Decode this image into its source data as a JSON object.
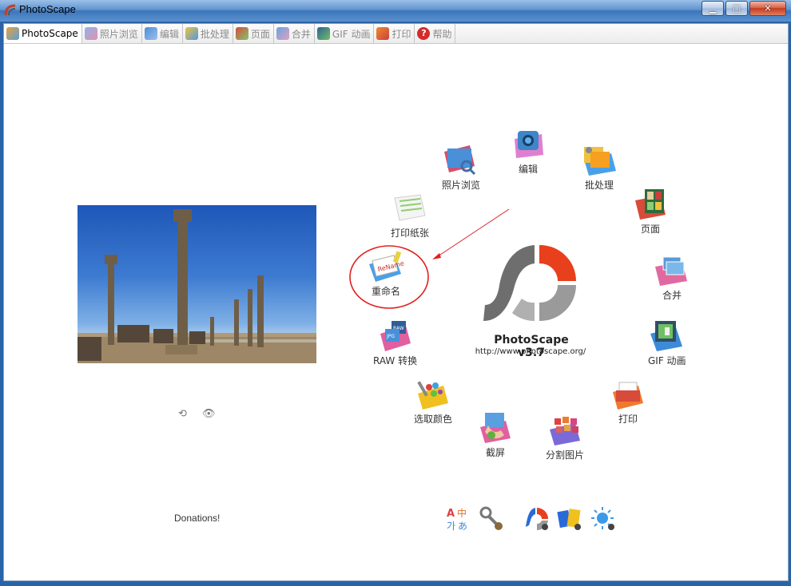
{
  "window": {
    "title": "PhotoScape"
  },
  "tabs": [
    {
      "label": "PhotoScape",
      "icon": "photoscape-icon",
      "active": true
    },
    {
      "label": "照片浏览",
      "icon": "viewer-icon",
      "active": false
    },
    {
      "label": "编辑",
      "icon": "editor-icon",
      "active": false
    },
    {
      "label": "批处理",
      "icon": "batch-icon",
      "active": false
    },
    {
      "label": "页面",
      "icon": "page-icon",
      "active": false
    },
    {
      "label": "合并",
      "icon": "combine-icon",
      "active": false
    },
    {
      "label": "GIF 动画",
      "icon": "gif-icon",
      "active": false
    },
    {
      "label": "打印",
      "icon": "print-icon",
      "active": false
    },
    {
      "label": "帮助",
      "icon": "help-icon",
      "active": false
    }
  ],
  "menu": {
    "editor": "编辑",
    "viewer": "照片浏览",
    "batch": "批处理",
    "print_paper": "打印纸张",
    "page": "页面",
    "rename": "重命名",
    "combine": "合并",
    "raw": "RAW 转换",
    "gif": "GIF 动画",
    "color_picker": "选取颜色",
    "print": "打印",
    "screen_capture": "截屏",
    "splitter": "分割图片"
  },
  "logo": {
    "title": "PhotoScape v3.7",
    "url": "http://www.photoscape.org/"
  },
  "photo_controls": {
    "prev": "⟲",
    "view": "👁"
  },
  "donations": "Donations!",
  "bottom_icons": [
    "language-icon",
    "tools-icon",
    "photoscape-x-icon",
    "splash-icon",
    "sun-icon"
  ],
  "colors": {
    "accent_red": "#e8401c",
    "annotation_red": "#e02020",
    "logo_gray": "#6e6e6e"
  }
}
